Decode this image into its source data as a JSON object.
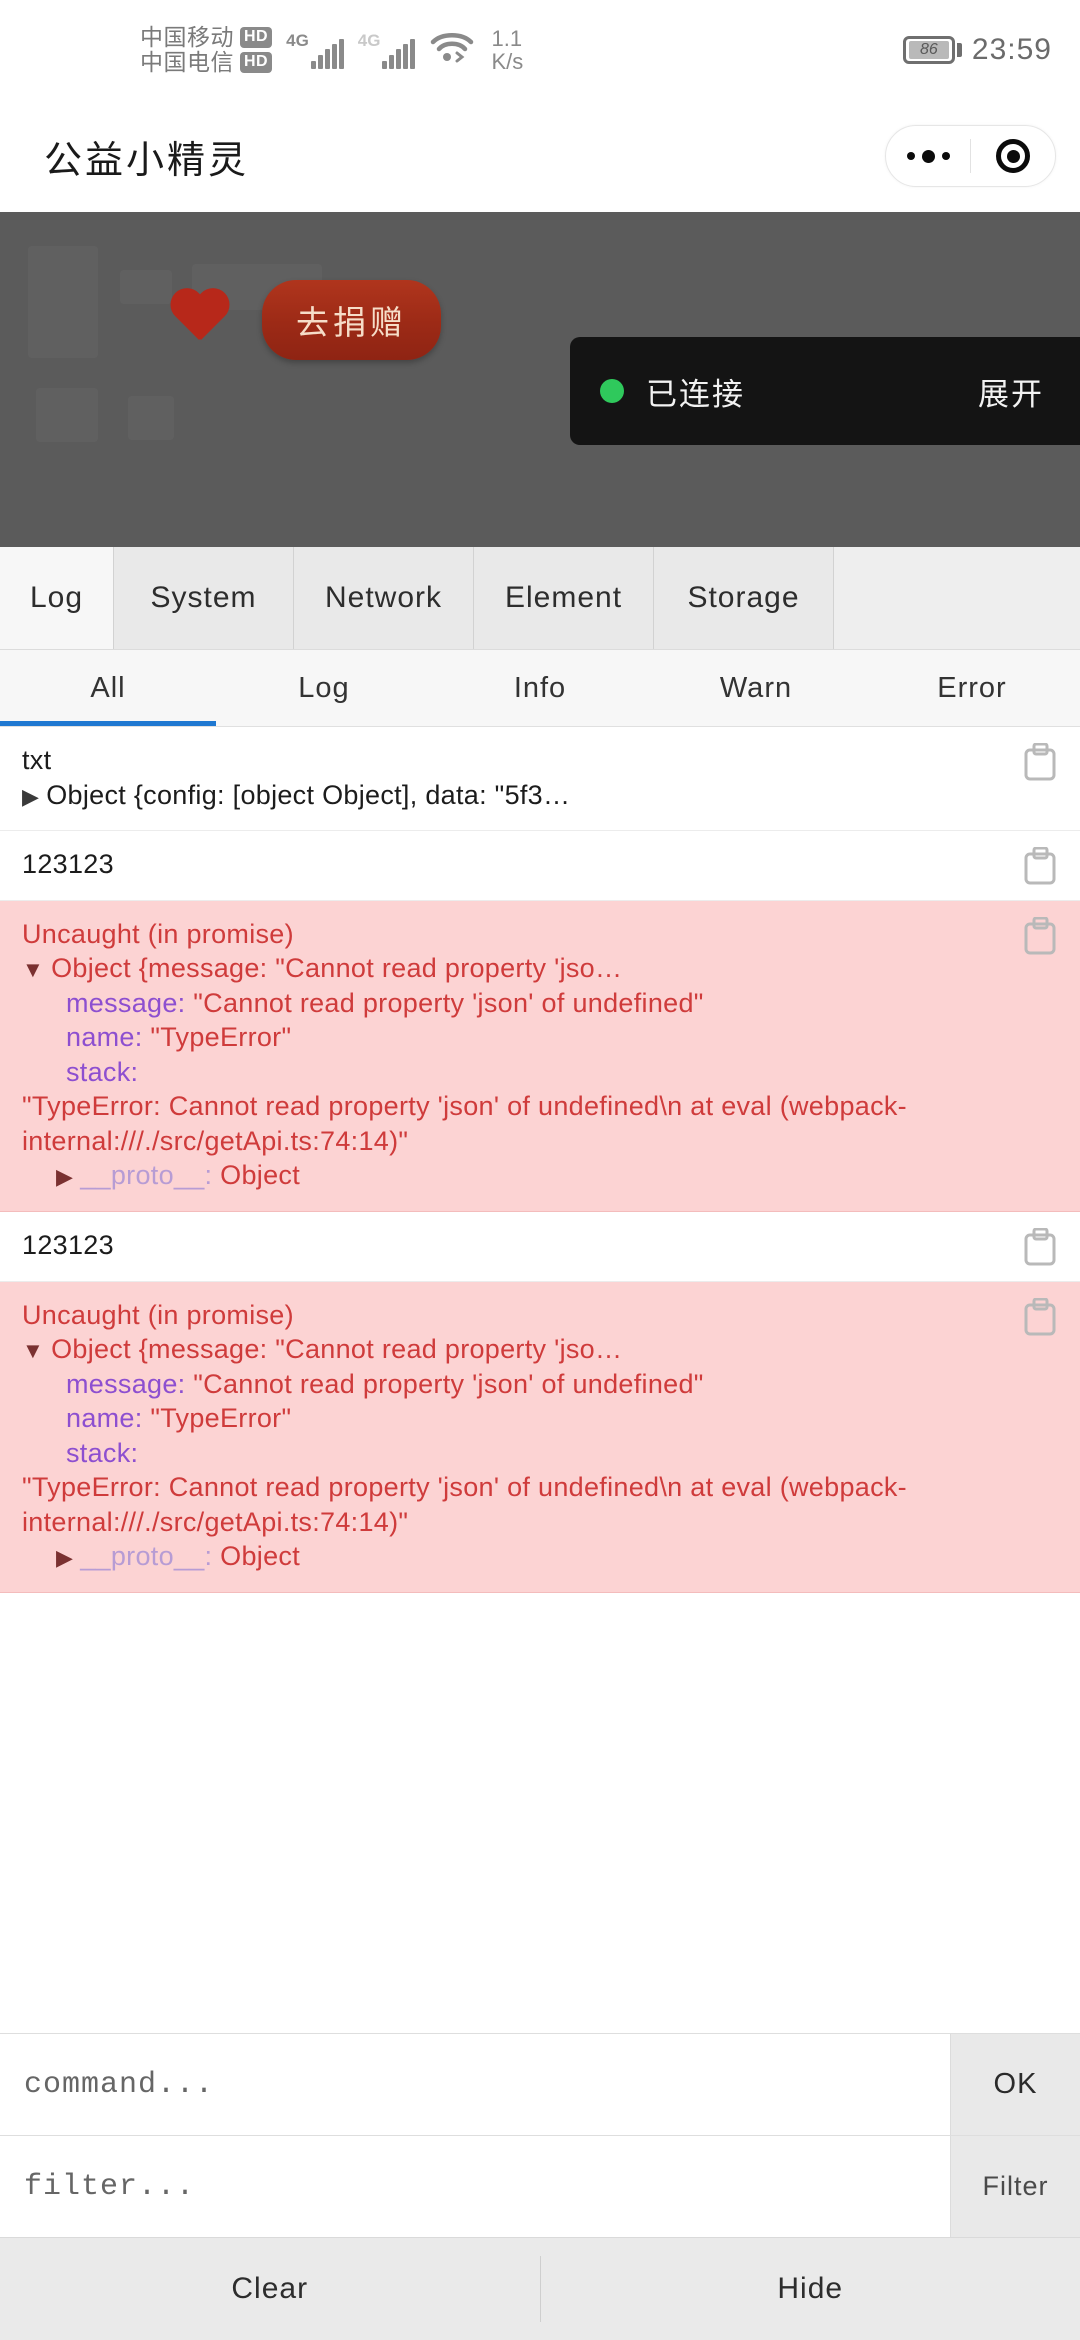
{
  "status_bar": {
    "carriers": [
      {
        "name": "中国移动",
        "badge": "HD"
      },
      {
        "name": "中国电信",
        "badge": "HD"
      }
    ],
    "network_1": "4G",
    "network_2": "4G",
    "net_speed_value": "1.1",
    "net_speed_unit": "K/s",
    "battery_level": "86",
    "time": "23:59"
  },
  "title_bar": {
    "app_title": "公益小精灵",
    "more_icon": "more-dots-icon",
    "capsule_close_icon": "target-circle-icon"
  },
  "webview": {
    "heart_icon": "heart-icon",
    "donate_button": "去捐赠",
    "connection": {
      "status_dot_color": "#2fc95c",
      "status_text": "已连接",
      "expand_label": "展开"
    }
  },
  "devtools": {
    "main_tabs": [
      {
        "label": "Log",
        "active": true
      },
      {
        "label": "System",
        "active": false
      },
      {
        "label": "Network",
        "active": false
      },
      {
        "label": "Element",
        "active": false
      },
      {
        "label": "Storage",
        "active": false
      }
    ],
    "filter_tabs": [
      {
        "label": "All",
        "active": true
      },
      {
        "label": "Log",
        "active": false
      },
      {
        "label": "Info",
        "active": false
      },
      {
        "label": "Warn",
        "active": false
      },
      {
        "label": "Error",
        "active": false
      }
    ],
    "active_tab_underline_color": "#1f78d1",
    "log_entries": [
      {
        "type": "log",
        "copy_icon": "copy-icon",
        "lines": [
          {
            "text": "txt",
            "style": "plain"
          },
          {
            "text": "Object {config: [object Object], data: \"5f3…",
            "style": "collapsed",
            "arrow": "▶"
          }
        ]
      },
      {
        "type": "log",
        "copy_icon": "copy-icon",
        "lines": [
          {
            "text": "123123",
            "style": "plain"
          }
        ]
      },
      {
        "type": "error",
        "copy_icon": "copy-icon",
        "lines": [
          {
            "text": "Uncaught (in promise)",
            "style": "plain"
          },
          {
            "text": "Object {message: \"Cannot read property 'jso…",
            "style": "expanded",
            "arrow": "▼"
          },
          {
            "key": "message: ",
            "text": "\"Cannot read property 'json' of undefined\"",
            "style": "prop"
          },
          {
            "key": "name: ",
            "text": "\"TypeError\"",
            "style": "prop"
          },
          {
            "key": "stack: ",
            "text": "",
            "style": "prop"
          },
          {
            "text": "\"TypeError: Cannot read property 'json' of undefined\\n    at eval (webpack-internal:///./src/getApi.ts:74:14)\"",
            "style": "plain"
          },
          {
            "key": "__proto__: ",
            "text": "Object",
            "style": "proto",
            "arrow": "▶"
          }
        ]
      },
      {
        "type": "log",
        "copy_icon": "copy-icon",
        "lines": [
          {
            "text": "123123",
            "style": "plain"
          }
        ]
      },
      {
        "type": "error",
        "copy_icon": "copy-icon",
        "lines": [
          {
            "text": "Uncaught (in promise)",
            "style": "plain"
          },
          {
            "text": "Object {message: \"Cannot read property 'jso…",
            "style": "expanded",
            "arrow": "▼"
          },
          {
            "key": "message: ",
            "text": "\"Cannot read property 'json' of undefined\"",
            "style": "prop"
          },
          {
            "key": "name: ",
            "text": "\"TypeError\"",
            "style": "prop"
          },
          {
            "key": "stack: ",
            "text": "",
            "style": "prop"
          },
          {
            "text": "\"TypeError: Cannot read property 'json' of undefined\\n    at eval (webpack-internal:///./src/getApi.ts:74:14)\"",
            "style": "plain"
          },
          {
            "key": "__proto__: ",
            "text": "Object",
            "style": "proto",
            "arrow": "▶"
          }
        ]
      }
    ],
    "command_placeholder": "command...",
    "command_value": "",
    "command_button": "OK",
    "filter_placeholder": "filter...",
    "filter_value": "",
    "filter_button": "Filter",
    "bottom_buttons": [
      {
        "label": "Clear"
      },
      {
        "label": "Hide"
      }
    ]
  }
}
